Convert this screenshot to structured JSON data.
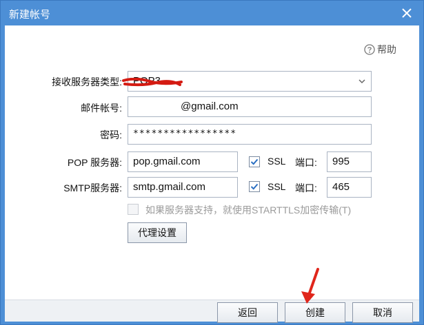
{
  "window": {
    "title": "新建帐号",
    "close_icon": "close-icon"
  },
  "help": {
    "label": "帮助",
    "icon": "question-circle-icon"
  },
  "form": {
    "server_type": {
      "label": "接收服务器类型:",
      "value": "POP3",
      "icon": "chevron-down-icon"
    },
    "account": {
      "label": "邮件帐号:",
      "value": "@gmail.com"
    },
    "password": {
      "label": "密码:",
      "value": "*****************"
    },
    "pop_server": {
      "label": "POP 服务器:",
      "value": "pop.gmail.com",
      "ssl_checked": true,
      "ssl_label": "SSL",
      "port_label": "端口:",
      "port": "995"
    },
    "smtp_server": {
      "label": "SMTP服务器:",
      "value": "smtp.gmail.com",
      "ssl_checked": true,
      "ssl_label": "SSL",
      "port_label": "端口:",
      "port": "465"
    },
    "starttls": {
      "label": "如果服务器支持，就使用STARTTLS加密传输(T)",
      "checked": false,
      "disabled": true
    },
    "proxy_button": "代理设置"
  },
  "buttons": {
    "back": "返回",
    "create": "创建",
    "cancel": "取消"
  },
  "colors": {
    "titlebar": "#4d8fd6",
    "check": "#2a6fc2",
    "annotation": "#e0261b"
  }
}
